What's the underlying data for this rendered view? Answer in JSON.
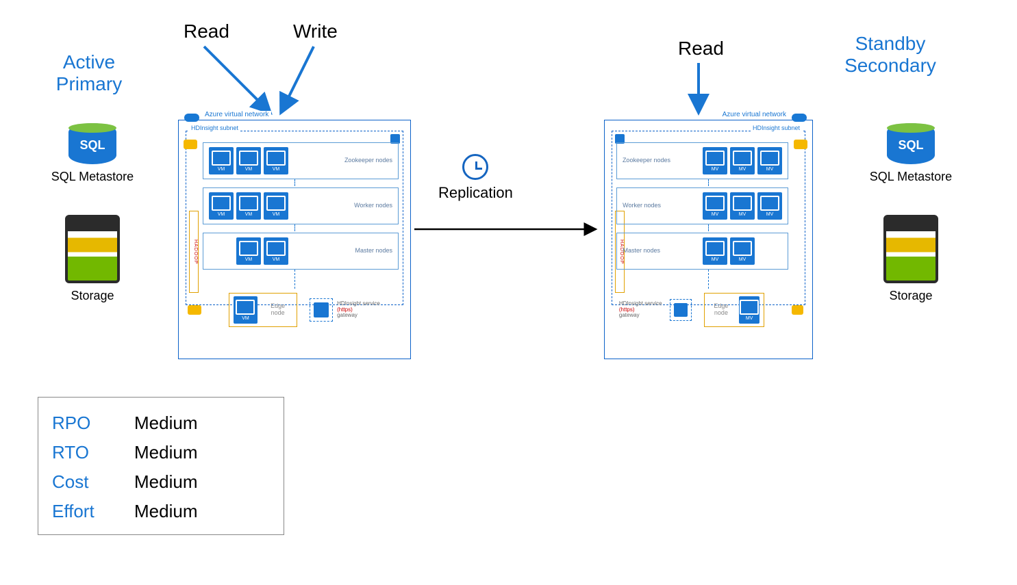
{
  "labels": {
    "active_primary": "Active Primary",
    "standby_secondary": "Standby Secondary",
    "read": "Read",
    "write": "Write",
    "sql_metastore": "SQL Metastore",
    "storage": "Storage",
    "replication": "Replication",
    "sql_badge": "SQL"
  },
  "vnet": {
    "title": "Azure virtual network",
    "subnet_label": "HDInsight subnet",
    "hadoop": "HADOOP",
    "tiers": {
      "zookeeper": "Zookeeper nodes",
      "worker": "Worker nodes",
      "master": "Master nodes"
    },
    "edge_label": "Edge node",
    "gateway_label": "HDInsight service",
    "gateway_proto": "(https)",
    "gateway_suffix": "gateway"
  },
  "metrics": [
    {
      "key": "RPO",
      "value": "Medium"
    },
    {
      "key": "RTO",
      "value": "Medium"
    },
    {
      "key": "Cost",
      "value": "Medium"
    },
    {
      "key": "Effort",
      "value": "Medium"
    }
  ]
}
